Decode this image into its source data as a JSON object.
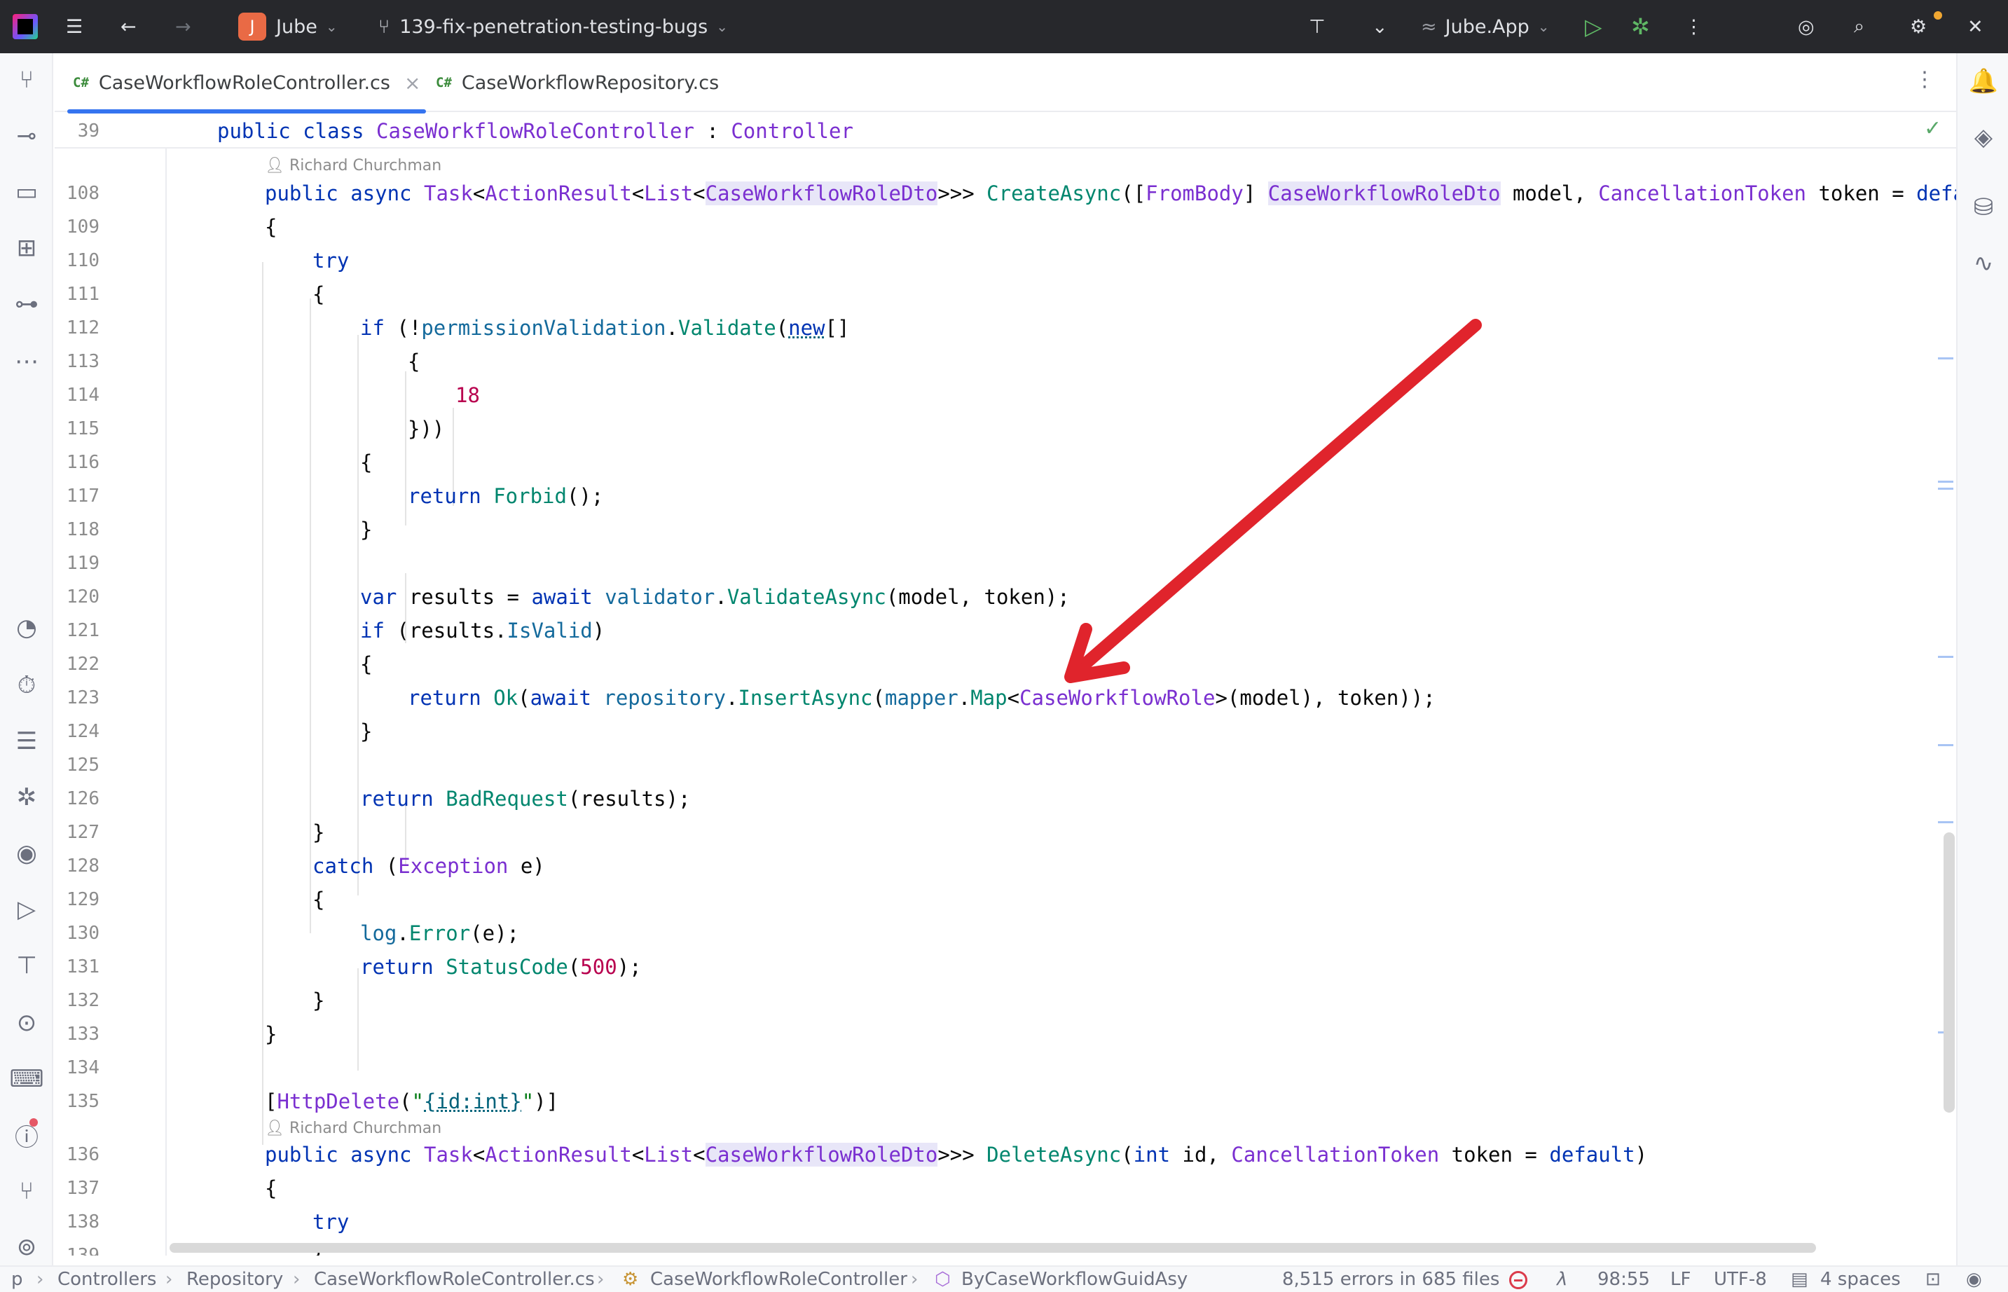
{
  "titlebar": {
    "project_initial": "J",
    "project_name": "Jube",
    "branch": "139-fix-penetration-testing-bugs",
    "run_config": "Jube.App"
  },
  "tabs": [
    {
      "lang": "C#",
      "label": "CaseWorkflowRoleController.cs"
    },
    {
      "lang": "C#",
      "label": "CaseWorkflowRepository.cs"
    }
  ],
  "editor": {
    "sticky_line": "39",
    "author_hint": "Richard Churchman",
    "line_numbers": [
      "108",
      "109",
      "110",
      "111",
      "112",
      "113",
      "114",
      "115",
      "116",
      "117",
      "118",
      "119",
      "120",
      "121",
      "122",
      "123",
      "124",
      "125",
      "126",
      "127",
      "128",
      "129",
      "130",
      "131",
      "132",
      "133",
      "134",
      "135",
      "136",
      "137",
      "138",
      "139"
    ]
  },
  "statusbar": {
    "crumb_root": "p",
    "crumbs": [
      "Controllers",
      "Repository",
      "CaseWorkflowRoleController.cs",
      "CaseWorkflowRoleController",
      "ByCaseWorkflowGuidAsy"
    ],
    "errors": "8,515 errors in 685 files",
    "position": "98:55",
    "line_ending": "LF",
    "encoding": "UTF-8",
    "indent": "4 spaces"
  },
  "colors": {
    "annotation_arrow": "#e0242c",
    "accent": "#3574f0"
  }
}
